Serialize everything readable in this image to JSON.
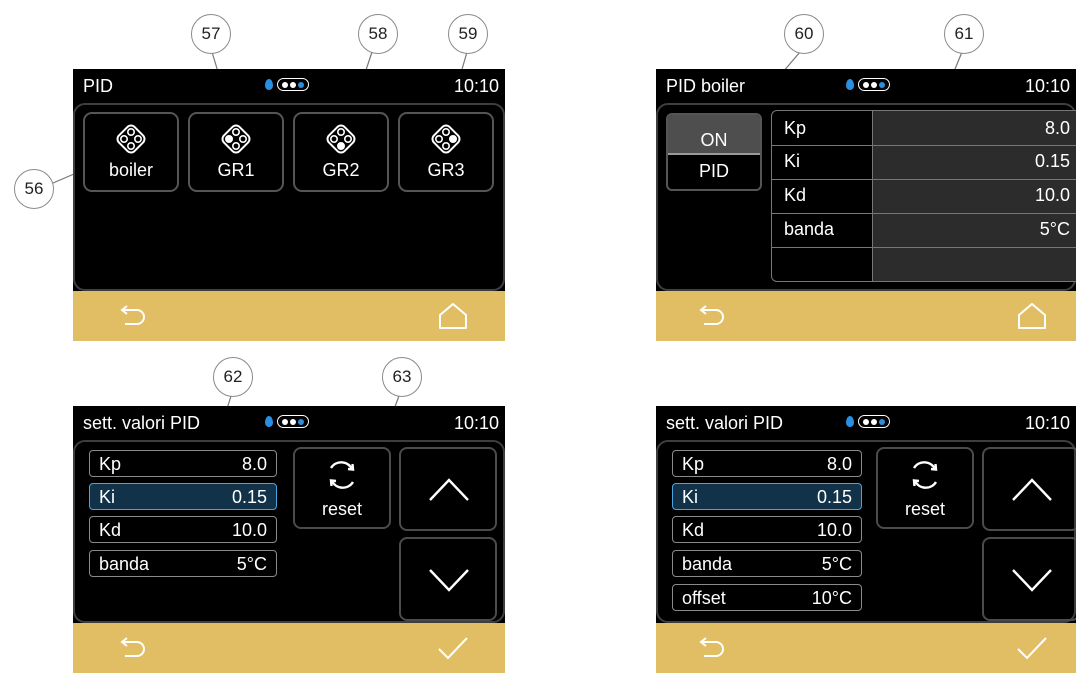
{
  "callouts": [
    "56",
    "57",
    "58",
    "59",
    "60",
    "61",
    "62",
    "63"
  ],
  "screen1": {
    "title": "PID",
    "time": "10:10",
    "tiles": [
      "boiler",
      "GR1",
      "GR2",
      "GR3"
    ]
  },
  "screen2": {
    "title": "PID boiler",
    "time": "10:10",
    "toggle_on": "ON",
    "toggle_pid": "PID",
    "params": [
      {
        "label": "Kp",
        "value": "8.0"
      },
      {
        "label": "Ki",
        "value": "0.15"
      },
      {
        "label": "Kd",
        "value": "10.0"
      },
      {
        "label": "banda",
        "value": "5°C"
      }
    ]
  },
  "screen3": {
    "title": "sett. valori PID",
    "time": "10:10",
    "params": [
      {
        "label": "Kp",
        "value": "8.0"
      },
      {
        "label": "Ki",
        "value": "0.15"
      },
      {
        "label": "Kd",
        "value": "10.0"
      },
      {
        "label": "banda",
        "value": "5°C"
      }
    ],
    "reset_label": "reset"
  },
  "screen4": {
    "title": "sett. valori PID",
    "time": "10:10",
    "params": [
      {
        "label": "Kp",
        "value": "8.0"
      },
      {
        "label": "Ki",
        "value": "0.15"
      },
      {
        "label": "Kd",
        "value": "10.0"
      },
      {
        "label": "banda",
        "value": "5°C"
      },
      {
        "label": "offset",
        "value": "10°C"
      }
    ],
    "reset_label": "reset"
  },
  "colors": {
    "screen_bg": "#000000",
    "footer": "#e1be63",
    "selected_field": "#113248",
    "selected_border": "#4da3dc",
    "accent_blue": "#2a8fe0"
  },
  "icons": [
    "drop-icon",
    "battery-indicator-icon",
    "back-arrow-icon",
    "home-icon",
    "check-icon",
    "boiler-icon",
    "reset-icon",
    "chevron-up-icon",
    "chevron-down-icon"
  ]
}
